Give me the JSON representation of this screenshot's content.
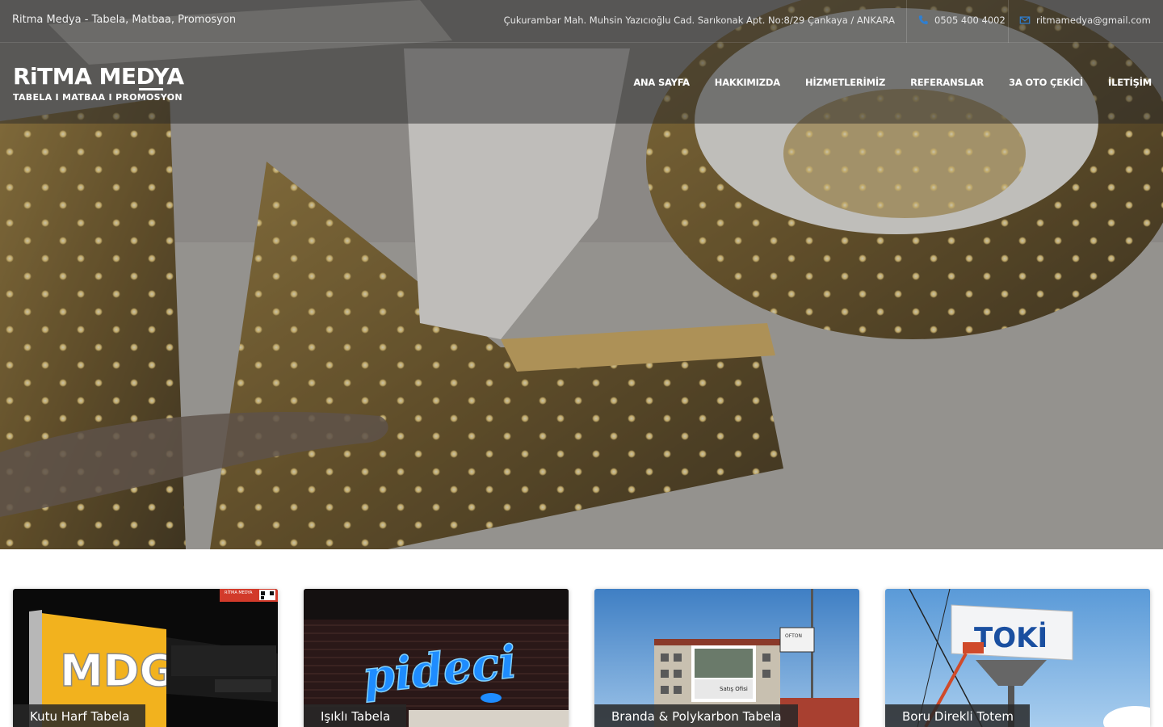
{
  "topbar": {
    "tagline": "Ritma Medya - Tabela, Matbaa, Promosyon",
    "address": "Çukurambar Mah. Muhsin Yazıcıoğlu Cad. Sarıkonak Apt. No:8/29 Çankaya / ANKARA",
    "phone": "0505 400 4002",
    "email": "ritmamedya@gmail.com",
    "phone_icon": "phone-icon",
    "email_icon": "envelope-icon"
  },
  "logo": {
    "brand": "RiTMA MEDYA",
    "subtitle": "TABELA I MATBAA I PROMOSYON"
  },
  "nav": {
    "items": [
      {
        "label": "ANA SAYFA"
      },
      {
        "label": "HAKKIMIZDA"
      },
      {
        "label": "HİZMETLERİMİZ"
      },
      {
        "label": "REFERANSLAR"
      },
      {
        "label": "3A OTO ÇEKİCİ"
      },
      {
        "label": "İLETİŞİM"
      }
    ]
  },
  "cards": [
    {
      "label": "Kutu Harf Tabela",
      "image_text": "MDG",
      "corner_text": "RİTMA MEDYA"
    },
    {
      "label": "Işıklı Tabela",
      "image_text": "pideci"
    },
    {
      "label": "Branda & Polykarbon Tabela",
      "image_text": "Satış Ofisi",
      "sign_text": "OFTON"
    },
    {
      "label": "Boru Direkli Totem",
      "image_text": "TOKİ"
    }
  ],
  "colors": {
    "accent": "#2f7fd1",
    "topbar_bg": "#3a3a3a",
    "text_white": "#ffffff"
  }
}
